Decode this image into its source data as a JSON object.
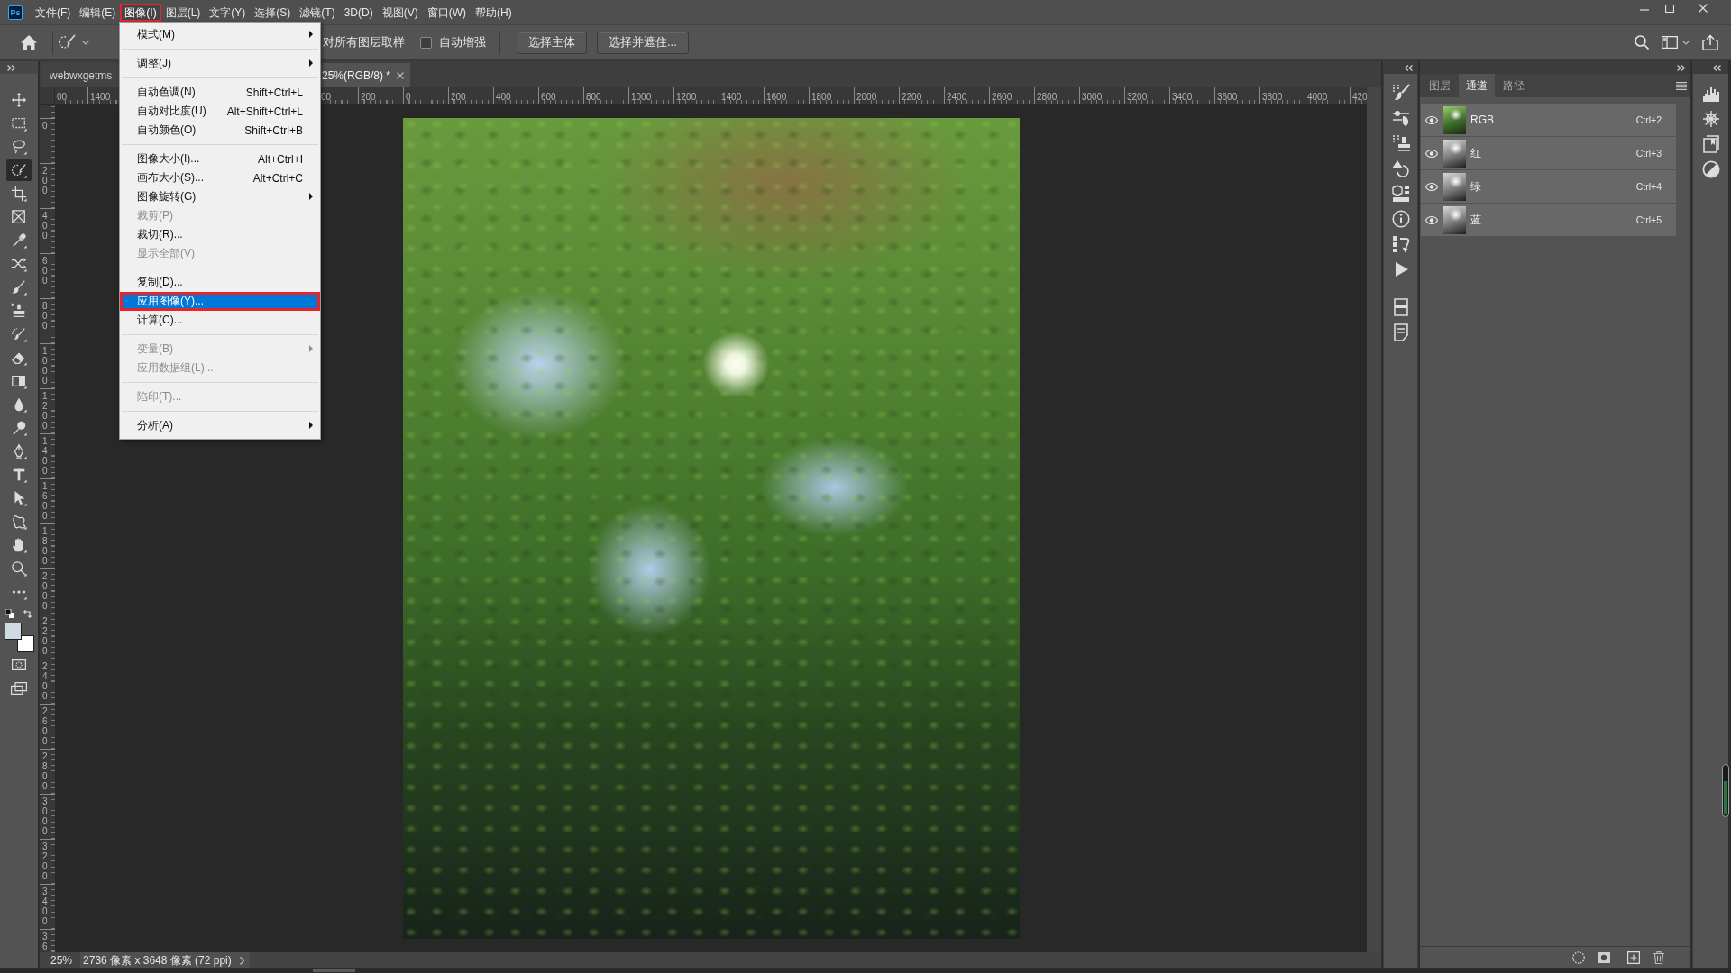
{
  "app": {
    "logo": "Ps"
  },
  "menu_bar": [
    {
      "label": "文件(F)",
      "selected": false,
      "outlined": false
    },
    {
      "label": "编辑(E)",
      "selected": false,
      "outlined": false
    },
    {
      "label": "图像(I)",
      "selected": true,
      "outlined": true
    },
    {
      "label": "图层(L)",
      "selected": false,
      "outlined": false
    },
    {
      "label": "文字(Y)",
      "selected": false,
      "outlined": false
    },
    {
      "label": "选择(S)",
      "selected": false,
      "outlined": false
    },
    {
      "label": "滤镜(T)",
      "selected": false,
      "outlined": false
    },
    {
      "label": "3D(D)",
      "selected": false,
      "outlined": false
    },
    {
      "label": "视图(V)",
      "selected": false,
      "outlined": false
    },
    {
      "label": "窗口(W)",
      "selected": false,
      "outlined": false
    },
    {
      "label": "帮助(H)",
      "selected": false,
      "outlined": false
    }
  ],
  "options_bar": {
    "sample_all_layers": {
      "label": "对所有图层取样"
    },
    "auto_enhance": {
      "label": "自动增强",
      "checked": false
    },
    "buttons": [
      "选择主体",
      "选择并遮住..."
    ]
  },
  "document_tabs": [
    {
      "label": "webwxgetms",
      "selected": false
    },
    {
      "label": "25%(RGB/8) *",
      "selected": true
    }
  ],
  "top_ruler": {
    "left_labels": [
      "00",
      "1400"
    ],
    "right_labels": [
      "00",
      "200",
      "0",
      "200",
      "400",
      "600",
      "800",
      "1000",
      "1200",
      "1400",
      "1600",
      "1800",
      "2000",
      "2200",
      "2400",
      "2600",
      "2800",
      "3000",
      "3200",
      "3400",
      "3600",
      "3800",
      "4000",
      "420"
    ]
  },
  "left_ruler": {
    "labels": [
      "0",
      "200",
      "400",
      "600",
      "800",
      "1000",
      "1200",
      "1400",
      "1600",
      "1800",
      "2000",
      "2200",
      "2400",
      "2600",
      "2800",
      "3000",
      "3200",
      "3400",
      "36"
    ]
  },
  "toolbar": {
    "tools": [
      {
        "kind": "move",
        "selected": false
      },
      {
        "kind": "marquee",
        "selected": false
      },
      {
        "kind": "lasso",
        "selected": false
      },
      {
        "kind": "quickselect",
        "selected": true
      },
      {
        "kind": "crop",
        "selected": false
      },
      {
        "kind": "frame",
        "selected": false
      },
      {
        "kind": "eyedropper",
        "selected": false
      },
      {
        "kind": "shuffle",
        "selected": false
      },
      {
        "kind": "brush",
        "selected": false
      },
      {
        "kind": "stamp",
        "selected": false
      },
      {
        "kind": "historybrush",
        "selected": false
      },
      {
        "kind": "eraser",
        "selected": false
      },
      {
        "kind": "gradient",
        "selected": false
      },
      {
        "kind": "drop",
        "selected": false
      },
      {
        "kind": "dodge",
        "selected": false
      },
      {
        "kind": "pen",
        "selected": false
      },
      {
        "kind": "type",
        "selected": false
      },
      {
        "kind": "pointer",
        "selected": false
      },
      {
        "kind": "shape",
        "selected": false
      },
      {
        "kind": "hand",
        "selected": false
      },
      {
        "kind": "zoom",
        "selected": false
      },
      {
        "kind": "more",
        "selected": false
      }
    ],
    "color_swatches": [
      {
        "kind": "background",
        "color": "#ffffff"
      },
      {
        "kind": "foreground",
        "color": "#cdd9e3"
      }
    ]
  },
  "image_menu": {
    "groups": [
      {
        "items": [
          {
            "label": "模式(M)",
            "disabled": false,
            "submenu": true,
            "selected": false,
            "outlined": false
          }
        ]
      },
      {
        "items": [
          {
            "label": "调整(J)",
            "disabled": false,
            "submenu": true,
            "selected": false,
            "outlined": false
          }
        ]
      },
      {
        "items": [
          {
            "label": "自动色调(N)",
            "shortcut": "Shift+Ctrl+L",
            "disabled": false,
            "submenu": false,
            "selected": false,
            "outlined": false
          },
          {
            "label": "自动对比度(U)",
            "shortcut": "Alt+Shift+Ctrl+L",
            "disabled": false,
            "submenu": false,
            "selected": false,
            "outlined": false
          },
          {
            "label": "自动颜色(O)",
            "shortcut": "Shift+Ctrl+B",
            "disabled": false,
            "submenu": false,
            "selected": false,
            "outlined": false
          }
        ]
      },
      {
        "items": [
          {
            "label": "图像大小(I)...",
            "shortcut": "Alt+Ctrl+I",
            "disabled": false,
            "submenu": false,
            "selected": false,
            "outlined": false
          },
          {
            "label": "画布大小(S)...",
            "shortcut": "Alt+Ctrl+C",
            "disabled": false,
            "submenu": false,
            "selected": false,
            "outlined": false
          },
          {
            "label": "图像旋转(G)",
            "disabled": false,
            "submenu": true,
            "selected": false,
            "outlined": false
          },
          {
            "label": "裁剪(P)",
            "disabled": true,
            "submenu": false,
            "selected": false,
            "outlined": false
          },
          {
            "label": "裁切(R)...",
            "disabled": false,
            "submenu": false,
            "selected": false,
            "outlined": false
          },
          {
            "label": "显示全部(V)",
            "disabled": true,
            "submenu": false,
            "selected": false,
            "outlined": false
          }
        ]
      },
      {
        "items": [
          {
            "label": "复制(D)...",
            "disabled": false,
            "submenu": false,
            "selected": false,
            "outlined": false
          },
          {
            "label": "应用图像(Y)...",
            "disabled": false,
            "submenu": false,
            "selected": true,
            "outlined": true
          },
          {
            "label": "计算(C)...",
            "disabled": false,
            "submenu": false,
            "selected": false,
            "outlined": false
          }
        ]
      },
      {
        "items": [
          {
            "label": "变量(B)",
            "disabled": true,
            "submenu": true,
            "selected": false,
            "outlined": false
          },
          {
            "label": "应用数据组(L)...",
            "disabled": true,
            "submenu": false,
            "selected": false,
            "outlined": false
          }
        ]
      },
      {
        "items": [
          {
            "label": "陷印(T)...",
            "disabled": true,
            "submenu": false,
            "selected": false,
            "outlined": false
          }
        ]
      },
      {
        "items": [
          {
            "label": "分析(A)",
            "disabled": false,
            "submenu": true,
            "selected": false,
            "outlined": false
          }
        ]
      }
    ]
  },
  "status_bar": {
    "zoom": "25%",
    "info": "2736 像素 x 3648 像素 (72 ppi)"
  },
  "channels_panel": {
    "tabs": [
      {
        "label": "图层",
        "selected": false
      },
      {
        "label": "通道",
        "selected": true
      },
      {
        "label": "路径",
        "selected": false
      }
    ],
    "channels": [
      {
        "name": "RGB",
        "shortcut": "Ctrl+2",
        "kind": "composite",
        "visible": true,
        "selected": true
      },
      {
        "name": "红",
        "shortcut": "Ctrl+3",
        "kind": "single",
        "visible": true,
        "selected": true
      },
      {
        "name": "绿",
        "shortcut": "Ctrl+4",
        "kind": "single",
        "visible": true,
        "selected": true
      },
      {
        "name": "蓝",
        "shortcut": "Ctrl+5",
        "kind": "single",
        "visible": true,
        "selected": true
      }
    ]
  }
}
